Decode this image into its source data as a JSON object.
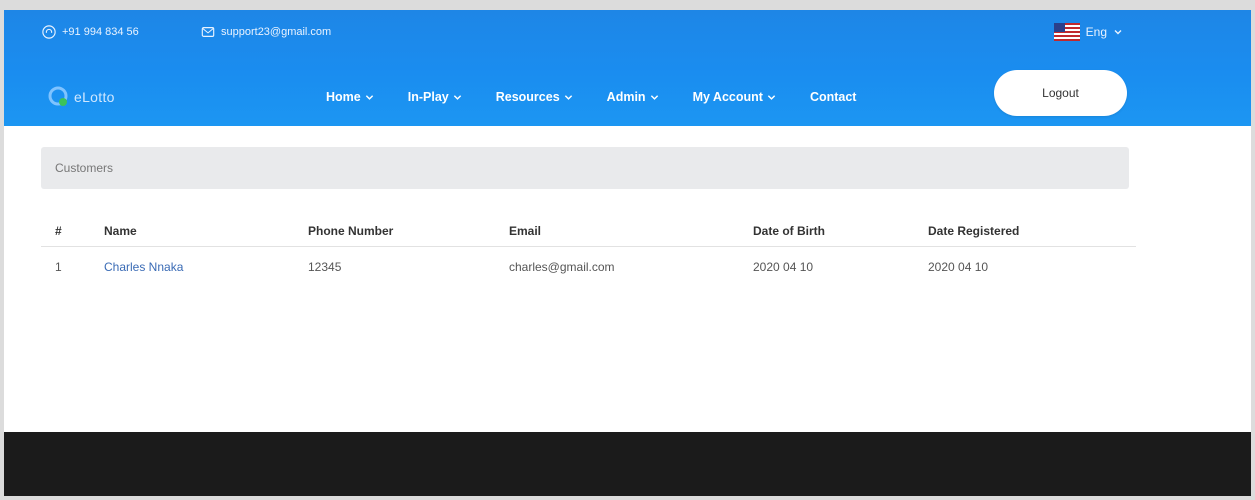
{
  "topbar": {
    "phone": "+91 994 834 56",
    "email": "support23@gmail.com",
    "language": "Eng"
  },
  "nav": {
    "logo_text": "eLotto",
    "items": [
      {
        "label": "Home",
        "has_dropdown": true
      },
      {
        "label": "In-Play",
        "has_dropdown": true
      },
      {
        "label": "Resources",
        "has_dropdown": true
      },
      {
        "label": "Admin",
        "has_dropdown": true
      },
      {
        "label": "My Account",
        "has_dropdown": true
      },
      {
        "label": "Contact",
        "has_dropdown": false
      }
    ],
    "logout_label": "Logout"
  },
  "breadcrumb": "Customers",
  "table": {
    "headers": [
      "#",
      "Name",
      "Phone Number",
      "Email",
      "Date of Birth",
      "Date Registered"
    ],
    "rows": [
      [
        "1",
        "Charles Nnaka",
        "12345",
        "charles@gmail.com",
        "2020 04 10",
        "2020 04 10"
      ]
    ]
  },
  "colors": {
    "header_blue": "#1a8df0",
    "footer_dark": "#1b1b1b",
    "breadcrumb_bg": "#e9eaec"
  }
}
